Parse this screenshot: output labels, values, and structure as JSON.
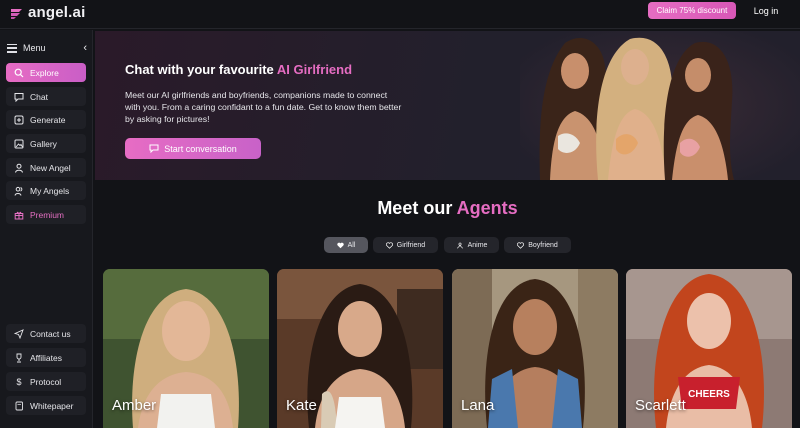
{
  "brand": {
    "name": "angel.ai"
  },
  "header": {
    "claim_label": "Claim 75% discount",
    "login_label": "Log in"
  },
  "sidebar": {
    "menu_label": "Menu",
    "items": [
      {
        "label": "Explore",
        "icon": "search-icon"
      },
      {
        "label": "Chat",
        "icon": "chat-icon"
      },
      {
        "label": "Generate",
        "icon": "plus-square-icon"
      },
      {
        "label": "Gallery",
        "icon": "image-icon"
      },
      {
        "label": "New Angel",
        "icon": "user-icon"
      },
      {
        "label": "My Angels",
        "icon": "users-icon"
      },
      {
        "label": "Premium",
        "icon": "gift-icon"
      }
    ],
    "bottom": [
      {
        "label": "Contact us",
        "icon": "send-icon"
      },
      {
        "label": "Affiliates",
        "icon": "trophy-icon"
      },
      {
        "label": "Protocol",
        "icon": "dollar-icon"
      },
      {
        "label": "Whitepaper",
        "icon": "book-icon"
      }
    ]
  },
  "hero": {
    "title_prefix": "Chat with your favourite ",
    "title_accent": "AI Girlfriend",
    "description": "Meet our AI girlfriends and boyfriends, companions made to connect with you. From a caring confidant to a fun date. Get to know them better by asking for pictures!",
    "cta_label": "Start conversation"
  },
  "agents": {
    "title_prefix": "Meet our ",
    "title_accent": "Agents",
    "filters": [
      {
        "label": "All",
        "icon": "heart-icon",
        "active": true
      },
      {
        "label": "Girlfriend",
        "icon": "heart-outline-icon",
        "active": false
      },
      {
        "label": "Anime",
        "icon": "anime-icon",
        "active": false
      },
      {
        "label": "Boyfriend",
        "icon": "heart-outline-icon",
        "active": false
      }
    ],
    "cards": [
      {
        "name": "Amber"
      },
      {
        "name": "Kate"
      },
      {
        "name": "Lana"
      },
      {
        "name": "Scarlett"
      }
    ]
  },
  "colors": {
    "accent": "#e56dc2",
    "background": "#121317",
    "sidebar": "#17181d",
    "button": "#1f2026"
  }
}
